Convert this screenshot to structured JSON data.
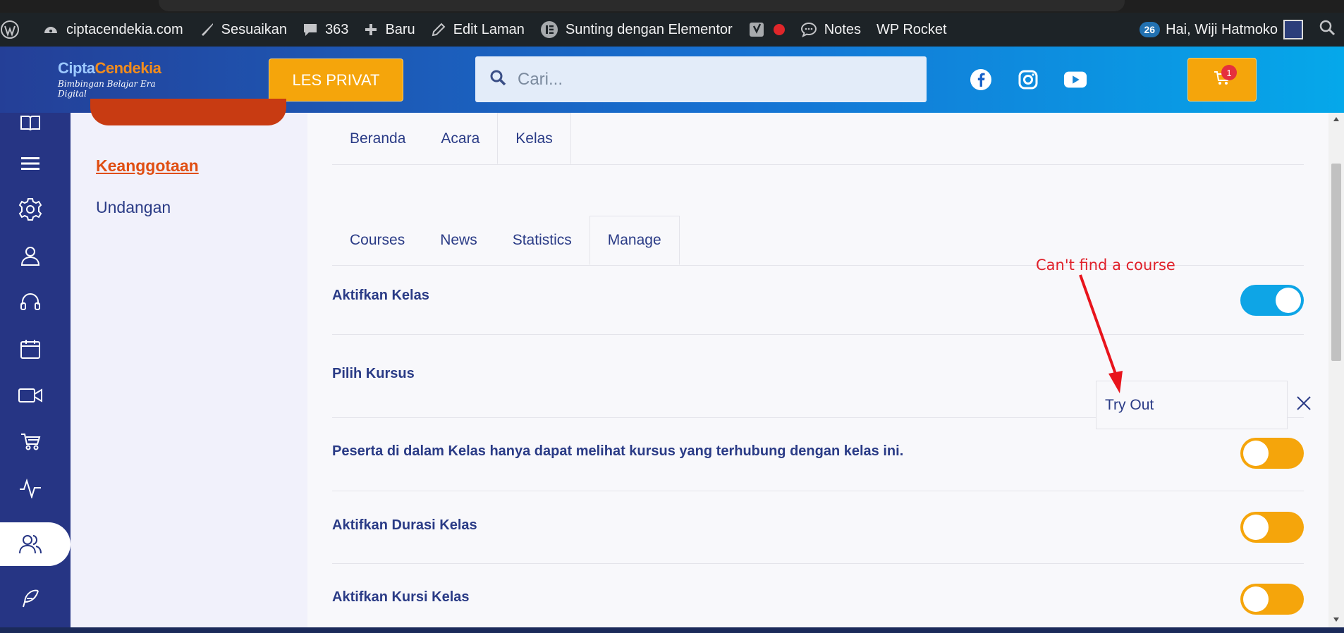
{
  "adminbar": {
    "site": "ciptacendekia.com",
    "customize": "Sesuaikan",
    "comments_count": "363",
    "new": "Baru",
    "edit_page": "Edit Laman",
    "elementor": "Sunting dengan Elementor",
    "notes": "Notes",
    "wp_rocket": "WP Rocket",
    "updates_badge": "26",
    "greeting": "Hai, Wiji Hatmoko"
  },
  "header": {
    "logo_part1": "Cipta",
    "logo_part2": "Cendekia",
    "logo_tagline": "Bimbingan Belajar Era Digital",
    "les_privat": "LES PRIVAT",
    "search_placeholder": "Cari...",
    "cart_count": "1",
    "social": [
      "facebook-icon",
      "instagram-icon",
      "youtube-icon"
    ]
  },
  "rail": {
    "icons": [
      "book-icon",
      "menu-icon",
      "gear-icon",
      "user-icon",
      "headset-icon",
      "calendar-icon",
      "video-icon",
      "cart-icon",
      "activity-icon",
      "users-icon",
      "feather-icon"
    ]
  },
  "subnav": {
    "active": "Keanggotaan",
    "item": "Undangan"
  },
  "tabs_primary": [
    "Beranda",
    "Acara",
    "Kelas"
  ],
  "tabs_secondary": [
    "Courses",
    "News",
    "Statistics",
    "Manage"
  ],
  "settings": {
    "activate_class": "Aktifkan Kelas",
    "choose_course": "Pilih Kursus",
    "selected_course": "Try Out",
    "participants_note": "Peserta di dalam Kelas hanya dapat melihat kursus yang terhubung dengan kelas ini.",
    "activate_duration": "Aktifkan Durasi Kelas",
    "activate_seats": "Aktifkan Kursi Kelas"
  },
  "annotation": "Can't find a course",
  "colors": {
    "accent_orange": "#f5a50b",
    "toggle_blue": "#0ea5e6",
    "navy": "#2a3b86",
    "annotation_red": "#e0202a"
  }
}
